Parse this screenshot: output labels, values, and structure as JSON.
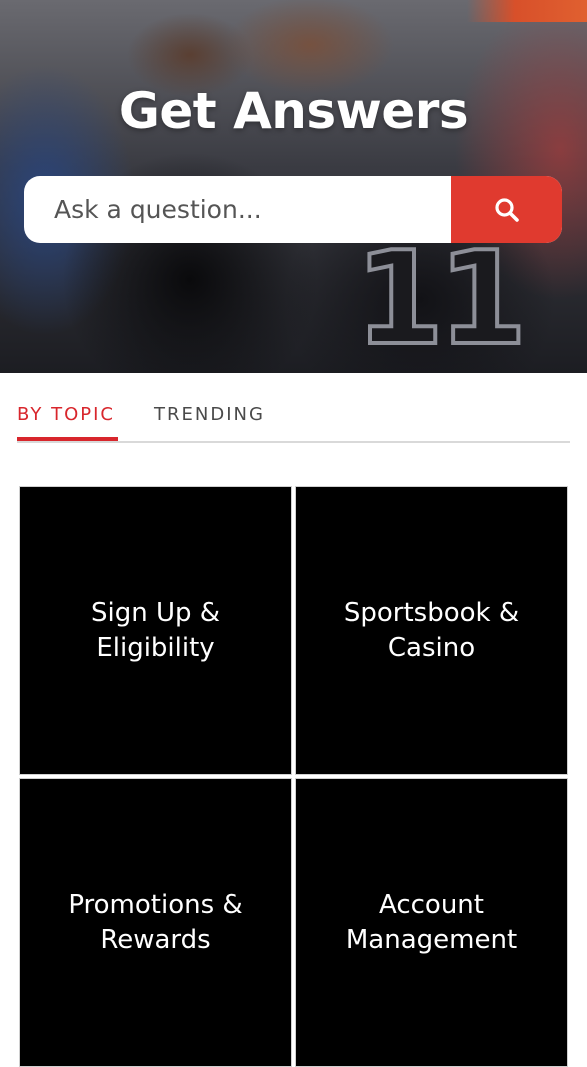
{
  "hero": {
    "title": "Get Answers",
    "jersey_number": "11",
    "search": {
      "placeholder": "Ask a question...",
      "value": "",
      "button_icon": "search-icon",
      "button_color": "#e03a2f"
    }
  },
  "tabs": [
    {
      "label": "BY TOPIC",
      "active": true
    },
    {
      "label": "TRENDING",
      "active": false
    }
  ],
  "accent_color": "#d8262c",
  "topics": [
    {
      "label": "Sign Up &\nEligibility"
    },
    {
      "label": "Sportsbook &\nCasino"
    },
    {
      "label": "Promotions &\nRewards"
    },
    {
      "label": "Account\nManagement"
    }
  ]
}
